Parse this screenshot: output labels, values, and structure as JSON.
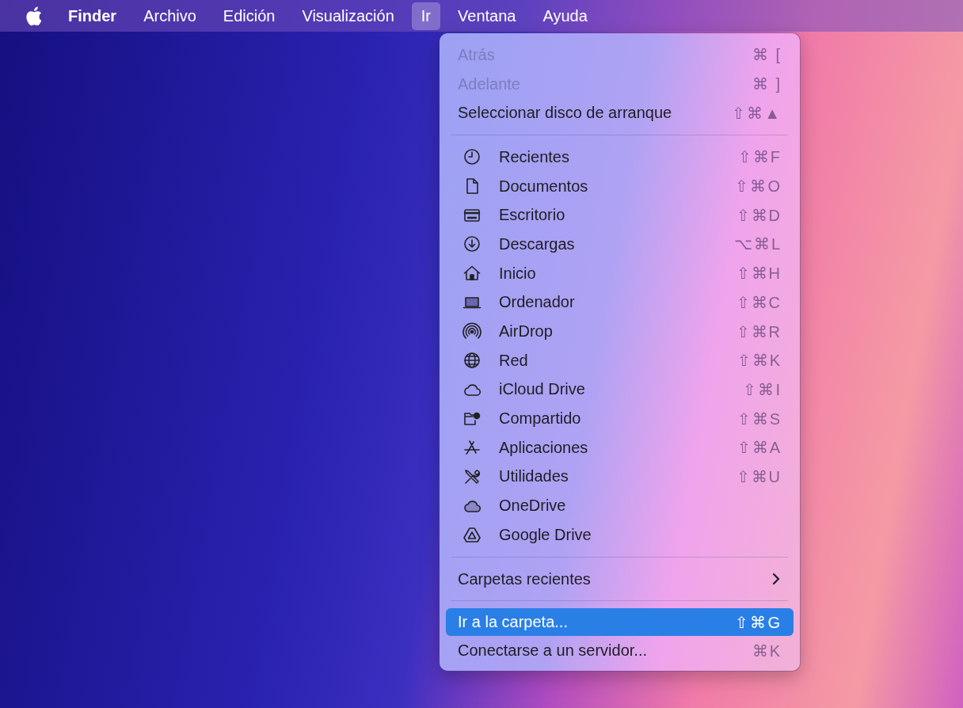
{
  "menu_bar": {
    "items": [
      {
        "label": "Finder",
        "kind": "app",
        "selected": false
      },
      {
        "label": "Archivo",
        "kind": "menu",
        "selected": false
      },
      {
        "label": "Edición",
        "kind": "menu",
        "selected": false
      },
      {
        "label": "Visualización",
        "kind": "menu",
        "selected": false
      },
      {
        "label": "Ir",
        "kind": "menu",
        "selected": true
      },
      {
        "label": "Ventana",
        "kind": "menu",
        "selected": false
      },
      {
        "label": "Ayuda",
        "kind": "menu",
        "selected": false
      }
    ]
  },
  "menu": {
    "sections": [
      {
        "items": [
          {
            "label": "Atrás",
            "shortcut": "⌘ [",
            "kind": "plain",
            "disabled": true,
            "selected": false
          },
          {
            "label": "Adelante",
            "shortcut": "⌘ ]",
            "kind": "plain",
            "disabled": true,
            "selected": false
          },
          {
            "label": "Seleccionar disco de arranque",
            "shortcut": "⇧⌘▲",
            "kind": "plain",
            "disabled": false,
            "selected": false
          }
        ]
      },
      {
        "items": [
          {
            "label": "Recientes",
            "shortcut": "⇧⌘F",
            "kind": "icon",
            "disabled": false,
            "selected": false
          },
          {
            "label": "Documentos",
            "shortcut": "⇧⌘O",
            "kind": "icon",
            "disabled": false,
            "selected": false
          },
          {
            "label": "Escritorio",
            "shortcut": "⇧⌘D",
            "kind": "icon",
            "disabled": false,
            "selected": false
          },
          {
            "label": "Descargas",
            "shortcut": "⌥⌘L",
            "kind": "icon",
            "disabled": false,
            "selected": false
          },
          {
            "label": "Inicio",
            "shortcut": "⇧⌘H",
            "kind": "icon",
            "disabled": false,
            "selected": false
          },
          {
            "label": "Ordenador",
            "shortcut": "⇧⌘C",
            "kind": "icon",
            "disabled": false,
            "selected": false
          },
          {
            "label": "AirDrop",
            "shortcut": "⇧⌘R",
            "kind": "icon",
            "disabled": false,
            "selected": false
          },
          {
            "label": "Red",
            "shortcut": "⇧⌘K",
            "kind": "icon",
            "disabled": false,
            "selected": false
          },
          {
            "label": "iCloud Drive",
            "shortcut": "⇧⌘I",
            "kind": "icon",
            "disabled": false,
            "selected": false
          },
          {
            "label": "Compartido",
            "shortcut": "⇧⌘S",
            "kind": "icon",
            "disabled": false,
            "selected": false
          },
          {
            "label": "Aplicaciones",
            "shortcut": "⇧⌘A",
            "kind": "icon",
            "disabled": false,
            "selected": false
          },
          {
            "label": "Utilidades",
            "shortcut": "⇧⌘U",
            "kind": "icon",
            "disabled": false,
            "selected": false
          },
          {
            "label": "OneDrive",
            "kind": "icon",
            "disabled": false,
            "selected": false
          },
          {
            "label": "Google Drive",
            "kind": "icon",
            "disabled": false,
            "selected": false
          }
        ]
      },
      {
        "items": [
          {
            "label": "Carpetas recientes",
            "kind": "submenu",
            "disabled": false,
            "selected": false
          }
        ]
      },
      {
        "items": [
          {
            "label": "Ir a la carpeta...",
            "shortcut": "⇧⌘G",
            "kind": "plain",
            "disabled": false,
            "selected": true
          },
          {
            "label": "Conectarse a un servidor...",
            "shortcut": "⌘K",
            "kind": "plain",
            "disabled": false,
            "selected": false
          }
        ]
      }
    ]
  }
}
